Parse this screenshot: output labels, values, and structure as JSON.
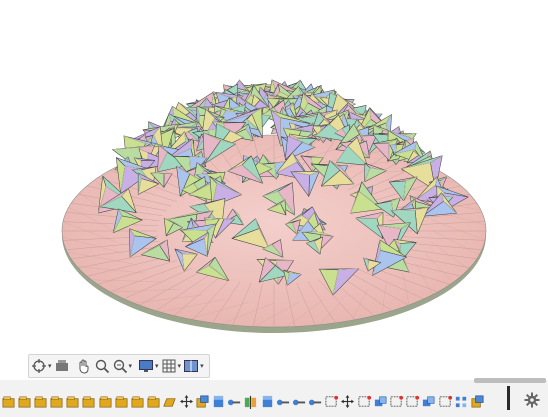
{
  "viewport": {
    "model": "faceted-dome-body",
    "colors": {
      "base": "#efc3bf",
      "edge": "#5b5b5b",
      "facets": [
        "#c9e08f",
        "#aac4ee",
        "#c8b0e6",
        "#e6de9a",
        "#9fd7c0",
        "#e7b7c8",
        "#b9dca0"
      ]
    }
  },
  "nav_toolbar": {
    "buttons": [
      {
        "icon": "orbit-icon",
        "has_menu": true
      },
      {
        "icon": "look-at-icon",
        "has_menu": false
      },
      {
        "icon": "pan-hand-icon",
        "has_menu": false
      },
      {
        "icon": "zoom-icon",
        "has_menu": false
      },
      {
        "icon": "fit-zoom-icon",
        "has_menu": true
      },
      {
        "icon": "display-settings-icon",
        "has_menu": true
      },
      {
        "icon": "grid-icon",
        "has_menu": true
      },
      {
        "icon": "viewports-icon",
        "has_menu": true
      }
    ]
  },
  "timeline": {
    "items": [
      "sketch-icon",
      "sketch-icon",
      "sketch-icon",
      "sketch-icon",
      "sketch-icon",
      "sketch-icon",
      "sketch-icon",
      "sketch-icon",
      "sketch-icon",
      "sketch-icon",
      "sketch-open-icon",
      "move-icon",
      "component-icon",
      "extrude-icon",
      "joint-icon",
      "mirror-icon",
      "extrude-icon",
      "joint-icon",
      "joint-icon",
      "joint-icon",
      "sketch-line-icon",
      "move-icon",
      "sketch-line-icon",
      "combine-icon",
      "sketch-line-icon",
      "sketch-line-icon",
      "combine-icon",
      "sketch-line-icon",
      "pattern-icon",
      "component-icon"
    ]
  }
}
